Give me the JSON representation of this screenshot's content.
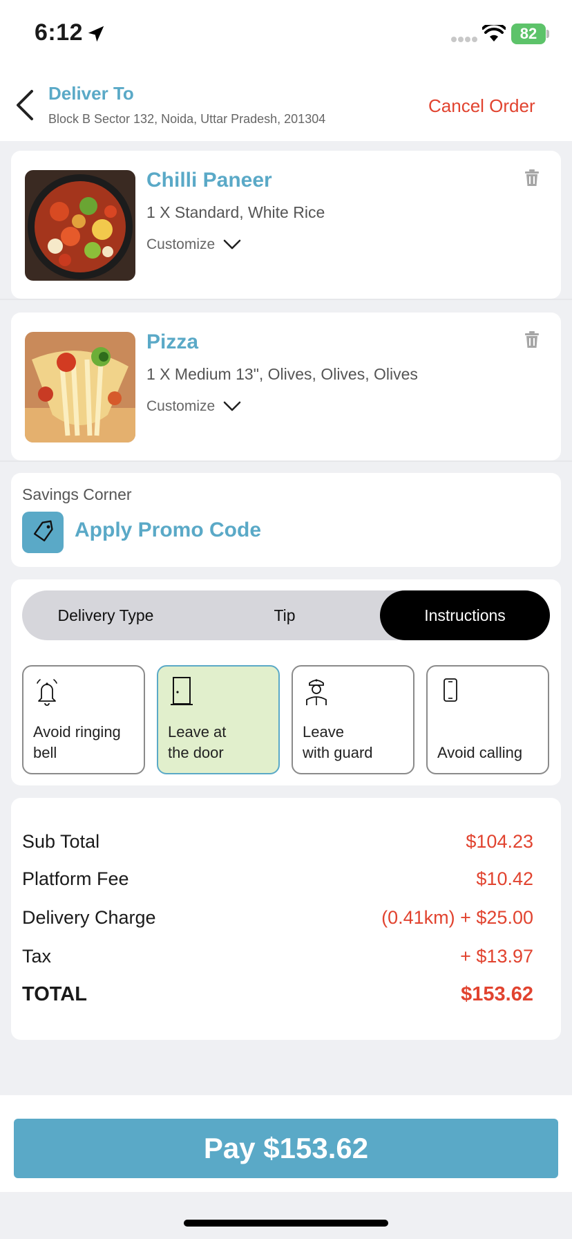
{
  "status": {
    "time": "6:12",
    "battery": "82"
  },
  "header": {
    "deliver_label": "Deliver To",
    "address": "Block B Sector 132, Noida, Uttar Pradesh, 201304",
    "cancel_label": "Cancel Order"
  },
  "items": [
    {
      "name": "Chilli Paneer",
      "description": "1 X Standard, White Rice",
      "customize": "Customize"
    },
    {
      "name": "Pizza",
      "description": "1 X Medium 13\", Olives, Olives, Olives",
      "customize": "Customize"
    }
  ],
  "savings": {
    "label": "Savings Corner",
    "promo": "Apply Promo Code"
  },
  "tabs": [
    {
      "label": "Delivery Type"
    },
    {
      "label": "Tip"
    },
    {
      "label": "Instructions",
      "active": true
    }
  ],
  "instructions": [
    {
      "label": "Avoid ringing\nbell",
      "icon": "bell-icon"
    },
    {
      "label": "Leave at\nthe door",
      "icon": "door-icon",
      "selected": true
    },
    {
      "label": "Leave\nwith guard",
      "icon": "guard-icon"
    },
    {
      "label": "Avoid calling",
      "icon": "phone-icon"
    }
  ],
  "summary": {
    "subtotal_label": "Sub Total",
    "subtotal": "$104.23",
    "platform_label": "Platform Fee",
    "platform": "$10.42",
    "delivery_label": "Delivery Charge",
    "delivery": "(0.41km) + $25.00",
    "tax_label": "Tax",
    "tax": "+ $13.97",
    "total_label": "TOTAL",
    "total": "$153.62"
  },
  "pay": {
    "label": "Pay $153.62"
  },
  "colors": {
    "accent": "#5aa9c7",
    "danger": "#e1432f",
    "selected_bg": "#e1efcc"
  }
}
